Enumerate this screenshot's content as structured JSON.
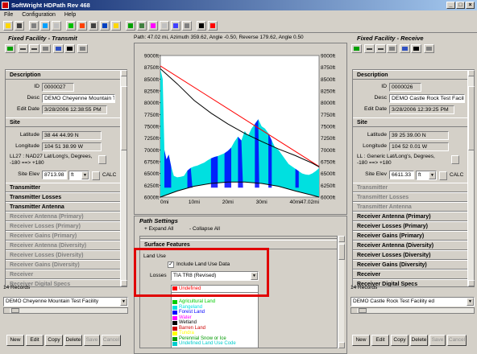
{
  "window": {
    "title": "SoftWright HDPath Rev 468",
    "buttons": [
      "_",
      "□",
      "×"
    ]
  },
  "menu": [
    "File",
    "Configuration",
    "Help"
  ],
  "path_info": "Path: 47.02 mi, Azimuth 359.62, Angle -0.50, Reverse 179.62, Angle 0.50",
  "left": {
    "header": "Fixed Facility - Transmit",
    "description": {
      "title": "Description",
      "id_label": "ID",
      "id": "0000027",
      "desc_label": "Desc",
      "desc": "DEMO Cheyenne Mountain Te",
      "edit_label": "Edit Date",
      "edit": "3/28/2006 12:38:55 PM"
    },
    "site": {
      "title": "Site",
      "lat_label": "Latitude",
      "lat": "38 44 44.99 N",
      "lon_label": "Longitude",
      "lon": "104 51 38.99 W",
      "datum": "LL27 : NAD27 Lat/Long's, Degrees, -180 ==> +180",
      "elev_label": "Site Elev",
      "elev": "8713.98",
      "unit": "ft",
      "calc": "CALC"
    },
    "sections": [
      {
        "label": "Transmitter",
        "dim": false
      },
      {
        "label": "Transmitter Losses",
        "dim": false
      },
      {
        "label": "Transmitter Antenna",
        "dim": false
      },
      {
        "label": "Receiver Antenna (Primary)",
        "dim": true
      },
      {
        "label": "Receiver Losses (Primary)",
        "dim": true
      },
      {
        "label": "Receiver Gains (Primary)",
        "dim": true
      },
      {
        "label": "Receiver Antenna (Diversity)",
        "dim": true
      },
      {
        "label": "Receiver Losses (Diversity)",
        "dim": true
      },
      {
        "label": "Receiver Gains (Diversity)",
        "dim": true
      },
      {
        "label": "Receiver",
        "dim": true
      },
      {
        "label": "Receiver Digital Specs",
        "dim": true
      }
    ],
    "records": "14 Records",
    "facility": "DEMO Cheyenne Mountain Test Facility",
    "buttons": {
      "new": "New",
      "edit": "Edit",
      "copy": "Copy",
      "delete": "Delete",
      "save": "Save",
      "cancel": "Cancel"
    }
  },
  "right": {
    "header": "Fixed Facility - Receive",
    "description": {
      "title": "Description",
      "id_label": "ID",
      "id": "0000026",
      "desc_label": "Desc",
      "desc": "DEMO Castle Rock Test Facilit",
      "edit_label": "Edit Date",
      "edit": "3/28/2006 12:39:25 PM"
    },
    "site": {
      "title": "Site",
      "lat_label": "Latitude",
      "lat": "39 25 39.00 N",
      "lon_label": "Longitude",
      "lon": "104 52 0.01 W",
      "datum": "LL : Generic Lat/Long's, Degrees, -180 ==> +180",
      "elev_label": "Site Elev",
      "elev": "6611.33",
      "unit": "ft",
      "calc": "CALC"
    },
    "sections": [
      {
        "label": "Transmitter",
        "dim": true
      },
      {
        "label": "Transmitter Losses",
        "dim": true
      },
      {
        "label": "Transmitter Antenna",
        "dim": true
      },
      {
        "label": "Receiver Antenna (Primary)",
        "dim": false
      },
      {
        "label": "Receiver Losses (Primary)",
        "dim": false
      },
      {
        "label": "Receiver Gains (Primary)",
        "dim": false
      },
      {
        "label": "Receiver Antenna (Diversity)",
        "dim": false
      },
      {
        "label": "Receiver Losses (Diversity)",
        "dim": false
      },
      {
        "label": "Receiver Gains (Diversity)",
        "dim": false
      },
      {
        "label": "Receiver",
        "dim": false
      },
      {
        "label": "Receiver Digital Specs",
        "dim": false
      }
    ],
    "records": "14 Records",
    "facility": "DEMO Castle Rock Test Facility ed",
    "buttons": {
      "new": "New",
      "edit": "Edit",
      "copy": "Copy",
      "delete": "Delete",
      "save": "Save",
      "cancel": "Cancel"
    }
  },
  "settings": {
    "title": "Path Settings",
    "expand": "+ Expand All",
    "collapse": "- Collapse All",
    "surface": "Surface Features",
    "land_use": "Land Use",
    "include": "Include Land Use Data",
    "losses_label": "Losses",
    "losses": "TIA TR8 (Revised)",
    "legend": [
      {
        "label": "Undefined",
        "color": "#ff0000"
      },
      {
        "label": "Agricultural Land",
        "color": "#00cc00"
      },
      {
        "label": "Rangeland",
        "color": "#00e0e0"
      },
      {
        "label": "Forest Land",
        "color": "#0000ff"
      },
      {
        "label": "Water",
        "color": "#ff00ff"
      },
      {
        "label": "Wetland",
        "color": "#000000"
      },
      {
        "label": "Barren Land",
        "color": "#cc0000"
      },
      {
        "label": "Tundra",
        "color": "#ffff00"
      },
      {
        "label": "Perennial Snow or Ice",
        "color": "#009900"
      },
      {
        "label": "Undefined Land Use Code",
        "color": "#00cccc"
      }
    ]
  },
  "chart_data": {
    "type": "area",
    "y_ticks": [
      "9000ft",
      "8750ft",
      "8500ft",
      "8250ft",
      "8000ft",
      "7750ft",
      "7500ft",
      "7250ft",
      "7000ft",
      "6750ft",
      "6500ft",
      "6250ft",
      "6000ft"
    ],
    "x_ticks": [
      "0mi",
      "10mi",
      "20mi",
      "30mi",
      "40mi",
      "47.02mi"
    ],
    "xlim": [
      0,
      47.02
    ],
    "ylim": [
      6000,
      9000
    ],
    "terrain": [
      [
        0,
        8714
      ],
      [
        0.7,
        8500
      ],
      [
        1.2,
        7000
      ],
      [
        1.8,
        6800
      ],
      [
        2.5,
        6900
      ],
      [
        3.2,
        6650
      ],
      [
        4,
        6450
      ],
      [
        5,
        6420
      ],
      [
        6,
        6430
      ],
      [
        7,
        6450
      ],
      [
        8,
        6560
      ],
      [
        9,
        6620
      ],
      [
        10,
        6650
      ],
      [
        11,
        6670
      ],
      [
        12,
        6700
      ],
      [
        13,
        6730
      ],
      [
        14,
        6780
      ],
      [
        15,
        6820
      ],
      [
        16,
        6850
      ],
      [
        17,
        6870
      ],
      [
        18,
        6900
      ],
      [
        19,
        6930
      ],
      [
        20,
        6980
      ],
      [
        21,
        7050
      ],
      [
        22,
        7180
      ],
      [
        23,
        7280
      ],
      [
        24,
        7200
      ],
      [
        25,
        7400
      ],
      [
        26,
        7300
      ],
      [
        27,
        7450
      ],
      [
        28,
        7550
      ],
      [
        29,
        7650
      ],
      [
        30,
        7500
      ],
      [
        31,
        7450
      ],
      [
        32,
        7350
      ],
      [
        33,
        7200
      ],
      [
        34,
        7050
      ],
      [
        35,
        7000
      ],
      [
        36,
        6900
      ],
      [
        37,
        6800
      ],
      [
        38,
        6700
      ],
      [
        39,
        6650
      ],
      [
        40,
        6600
      ],
      [
        41,
        6550
      ],
      [
        42,
        6500
      ],
      [
        43,
        6480
      ],
      [
        44,
        6470
      ],
      [
        45,
        6500
      ],
      [
        46,
        6550
      ],
      [
        47.02,
        6611
      ]
    ],
    "los_line": [
      [
        0,
        8780
      ],
      [
        47.02,
        6650
      ]
    ],
    "fresnel_curve": [
      [
        0,
        8720
      ],
      [
        5,
        8400
      ],
      [
        10,
        8050
      ],
      [
        15,
        7780
      ],
      [
        20,
        7550
      ],
      [
        25,
        7350
      ],
      [
        30,
        7180
      ],
      [
        35,
        7020
      ],
      [
        40,
        6880
      ],
      [
        45,
        6720
      ],
      [
        47.02,
        6640
      ]
    ],
    "earth_curve": [
      [
        0,
        6000
      ],
      [
        5,
        6130
      ],
      [
        10,
        6230
      ],
      [
        15,
        6290
      ],
      [
        20,
        6320
      ],
      [
        25,
        6320
      ],
      [
        30,
        6290
      ],
      [
        35,
        6230
      ],
      [
        40,
        6130
      ],
      [
        45,
        6040
      ],
      [
        47.02,
        6000
      ]
    ],
    "colors": {
      "terrain": "#00e0e0",
      "forest": "#0000ff",
      "los": "#ff0000",
      "fresnel": "#000000",
      "earth": "#000000"
    }
  }
}
